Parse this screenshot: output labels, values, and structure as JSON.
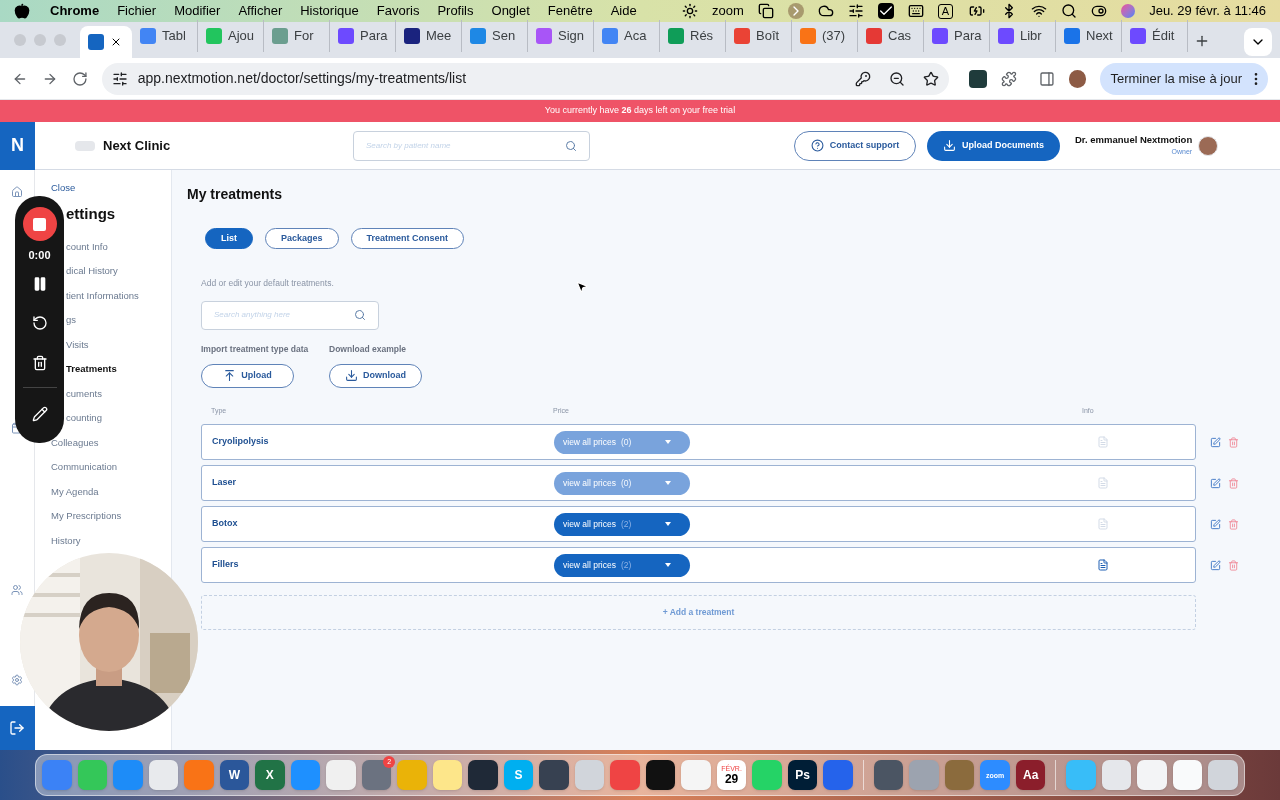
{
  "menu_bar": {
    "app": "Chrome",
    "menus": [
      "Fichier",
      "Modifier",
      "Afficher",
      "Historique",
      "Favoris",
      "Profils",
      "Onglet",
      "Fenêtre",
      "Aide"
    ],
    "zoom_label": "zoom",
    "input_label": "A",
    "clock": "Jeu. 29 févr. à 11:46"
  },
  "browser": {
    "tabs": [
      {
        "selected": true,
        "color": "#1565c0"
      },
      {
        "title": "Tabl",
        "selected": false,
        "color": "#4285f4"
      },
      {
        "title": "Ajou",
        "selected": false,
        "color": "#22c55e"
      },
      {
        "title": "For",
        "selected": false,
        "color": "#6b9e8f"
      },
      {
        "title": "Para",
        "selected": false,
        "color": "#6d4aff"
      },
      {
        "title": "Mee",
        "selected": false,
        "color": "#1a237e"
      },
      {
        "title": "Sen",
        "selected": false,
        "color": "#1e88e5"
      },
      {
        "title": "Sign",
        "selected": false,
        "color": "#a855f7"
      },
      {
        "title": "Aca",
        "selected": false,
        "color": "#4285f4"
      },
      {
        "title": "Rés",
        "selected": false,
        "color": "#0f9d58"
      },
      {
        "title": "Boît",
        "selected": false,
        "color": "#ea4335"
      },
      {
        "title": "(37)",
        "selected": false,
        "color": "#f97316"
      },
      {
        "title": "Cas",
        "selected": false,
        "color": "#e53935"
      },
      {
        "title": "Para",
        "selected": false,
        "color": "#6d4aff"
      },
      {
        "title": "Libr",
        "selected": false,
        "color": "#6d4aff"
      },
      {
        "title": "Next",
        "selected": false,
        "color": "#1a73e8"
      },
      {
        "title": "Édit",
        "selected": false,
        "color": "#6d4aff"
      }
    ],
    "address": "app.nextmotion.net/doctor/settings/my-treatments/list",
    "update_button": "Terminer la mise à jour"
  },
  "banner": "You currently have **26** days left on your free trial",
  "header": {
    "logo": "N",
    "clinic": "Next Clinic",
    "search_placeholder": "Search by patient name",
    "contact": "Contact support",
    "upload": "Upload Documents",
    "user": "Dr. emmanuel Nextmotion",
    "role": "Owner"
  },
  "settings": {
    "close": "Close",
    "title": "ettings",
    "items": [
      {
        "label": "count Info",
        "selected": false
      },
      {
        "label": "dical History",
        "selected": false
      },
      {
        "label": "tient Informations",
        "selected": false
      },
      {
        "label": "gs",
        "selected": false
      },
      {
        "label": "Visits",
        "selected": false
      },
      {
        "label": "Treatments",
        "selected": true
      },
      {
        "label": "cuments",
        "selected": false
      },
      {
        "label": "counting",
        "selected": false
      },
      {
        "label": "Colleagues",
        "selected": false
      },
      {
        "label": "Communication",
        "selected": false
      },
      {
        "label": "My Agenda",
        "selected": false
      },
      {
        "label": "My Prescriptions",
        "selected": false
      },
      {
        "label": "History",
        "selected": false
      }
    ]
  },
  "recorder": {
    "time": "0:00"
  },
  "page": {
    "title": "My treatments",
    "tabs": [
      {
        "label": "List",
        "selected": true
      },
      {
        "label": "Packages",
        "selected": false
      },
      {
        "label": "Treatment Consent",
        "selected": false
      }
    ],
    "hint": "Add or edit your default treatments.",
    "search_placeholder": "Search anything here",
    "import_label": "Import treatment type data",
    "download_label": "Download example",
    "upload_button": "Upload",
    "download_button": "Download",
    "columns": [
      "Type",
      "Price",
      "Info"
    ],
    "rows": [
      {
        "name": "Cryolipolysis",
        "price_button": "view all prices",
        "count": "(0)",
        "disabled": true,
        "has_info": false
      },
      {
        "name": "Laser",
        "price_button": "view all prices",
        "count": "(0)",
        "disabled": true,
        "has_info": false
      },
      {
        "name": "Botox",
        "price_button": "view all prices",
        "count": "(2)",
        "disabled": false,
        "has_info": false
      },
      {
        "name": "Fillers",
        "price_button": "view all prices",
        "count": "(2)",
        "disabled": false,
        "has_info": true
      }
    ],
    "add": "+ Add a treatment"
  },
  "dock": {
    "apps": [
      {
        "color": "#3b82f6"
      },
      {
        "color": "#34c759"
      },
      {
        "color": "#1d8cf8"
      },
      {
        "color": "#e8eaed"
      },
      {
        "color": "#f97316"
      },
      {
        "color": "#2b579a",
        "label": "W"
      },
      {
        "color": "#217346",
        "label": "X"
      },
      {
        "color": "#1e90ff"
      },
      {
        "color": "#f0f0f0"
      },
      {
        "color": "#6b7280",
        "badge": "2"
      },
      {
        "color": "#eab308"
      },
      {
        "color": "#fde68a"
      },
      {
        "color": "#1f2937"
      },
      {
        "color": "#00aff0",
        "label": "S"
      },
      {
        "color": "#374151"
      },
      {
        "color": "#d1d5db"
      },
      {
        "color": "#ef4444"
      },
      {
        "color": "#111111"
      },
      {
        "color": "#f5f5f5"
      },
      {
        "color": "#ffffff",
        "label": "29",
        "sub": "FÉVR."
      },
      {
        "color": "#25d366"
      },
      {
        "color": "#001e36",
        "label": "Ps"
      },
      {
        "color": "#2563eb"
      }
    ],
    "utilities": [
      {
        "color": "#4b5563"
      },
      {
        "color": "#9ca3af"
      },
      {
        "color": "#8b6b3d"
      },
      {
        "color": "#2d8cff",
        "label": "zoom"
      },
      {
        "color": "#8b1e2b",
        "label": "Aa"
      }
    ],
    "stack": [
      {
        "color": "#38bdf8"
      },
      {
        "color": "#e5e7eb"
      },
      {
        "color": "#f3f4f6"
      },
      {
        "color": "#f9fafb"
      },
      {
        "color": "#d1d5db"
      }
    ]
  }
}
